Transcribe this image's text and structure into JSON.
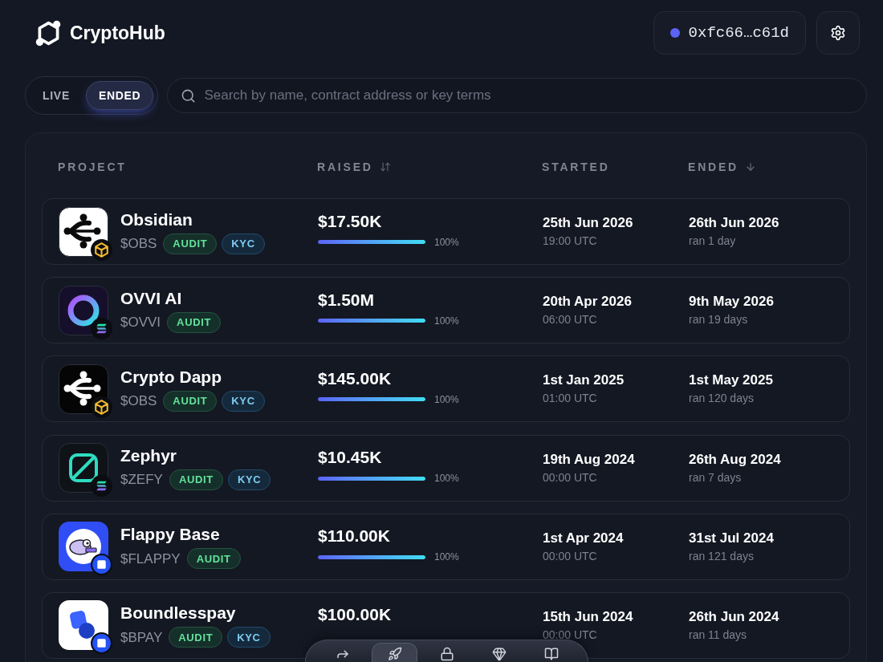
{
  "header": {
    "brand": "CryptoHub",
    "wallet": {
      "address": "0xfc66…c61d"
    }
  },
  "filter_tabs": [
    {
      "label": "LIVE",
      "selected": false
    },
    {
      "label": "ENDED",
      "selected": true
    }
  ],
  "search": {
    "placeholder": "Search by name, contract address or key terms"
  },
  "table": {
    "columns": [
      {
        "label": "PROJECT",
        "sortable": false
      },
      {
        "label": "RAISED",
        "sortable": true
      },
      {
        "label": "STARTED",
        "sortable": false
      },
      {
        "label": "ENDED",
        "sortable": true,
        "sorted": true
      }
    ],
    "rows": [
      {
        "name": "Obsidian",
        "ticker": "$OBS",
        "tags": [
          {
            "label": "AUDIT",
            "kind": "audit"
          },
          {
            "label": "KYC",
            "kind": "kyc"
          }
        ],
        "raised": "$17.50K",
        "progress": {
          "level": 1,
          "reading": "100%"
        },
        "started": {
          "date": "25th Jun 2026",
          "time": "19:00 UTC"
        },
        "ended": {
          "date": "26th Jun 2026",
          "duration": "ran 1 day"
        }
      },
      {
        "name": "OVVI AI",
        "ticker": "$OVVI",
        "tags": [
          {
            "label": "AUDIT",
            "kind": "audit"
          }
        ],
        "raised": "$1.50M",
        "progress": {
          "level": 1,
          "reading": "100%"
        },
        "started": {
          "date": "20th Apr 2026",
          "time": "06:00 UTC"
        },
        "ended": {
          "date": "9th May 2026",
          "duration": "ran 19 days"
        }
      },
      {
        "name": "Crypto Dapp",
        "ticker": "$OBS",
        "tags": [
          {
            "label": "AUDIT",
            "kind": "audit"
          },
          {
            "label": "KYC",
            "kind": "kyc"
          }
        ],
        "raised": "$145.00K",
        "progress": {
          "level": 1,
          "reading": "100%"
        },
        "started": {
          "date": "1st Jan 2025",
          "time": "01:00 UTC"
        },
        "ended": {
          "date": "1st May 2025",
          "duration": "ran 120 days"
        }
      },
      {
        "name": "Zephyr",
        "ticker": "$ZEFY",
        "tags": [
          {
            "label": "AUDIT",
            "kind": "audit"
          },
          {
            "label": "KYC",
            "kind": "kyc"
          }
        ],
        "raised": "$10.45K",
        "progress": {
          "level": 1,
          "reading": "100%"
        },
        "started": {
          "date": "19th Aug 2024",
          "time": "00:00 UTC"
        },
        "ended": {
          "date": "26th Aug 2024",
          "duration": "ran 7 days"
        }
      },
      {
        "name": "Flappy Base",
        "ticker": "$FLAPPY",
        "tags": [
          {
            "label": "AUDIT",
            "kind": "audit"
          }
        ],
        "raised": "$110.00K",
        "progress": {
          "level": 1,
          "reading": "100%"
        },
        "started": {
          "date": "1st Apr 2024",
          "time": "00:00 UTC"
        },
        "ended": {
          "date": "31st Jul 2024",
          "duration": "ran 121 days"
        }
      },
      {
        "name": "Boundlesspay",
        "ticker": "$BPAY",
        "tags": [
          {
            "label": "AUDIT",
            "kind": "audit"
          },
          {
            "label": "KYC",
            "kind": "kyc"
          }
        ],
        "raised": "$100.00K",
        "started": {
          "date": "15th Jun 2024",
          "time": "00:00 UTC"
        },
        "ended": {
          "date": "26th Jun 2024",
          "duration": "ran 11 days"
        }
      }
    ]
  },
  "dock": {
    "items": [
      {
        "selected": false
      },
      {
        "selected": true
      },
      {
        "selected": false
      },
      {
        "selected": false
      },
      {
        "selected": false
      }
    ]
  }
}
